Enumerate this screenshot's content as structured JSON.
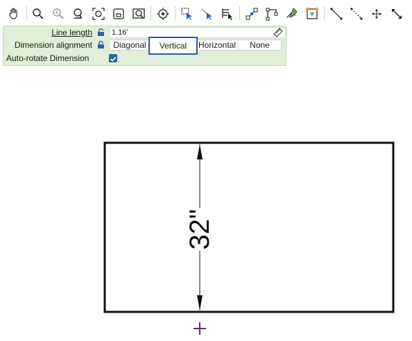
{
  "toolbar": {
    "icons": [
      "pan-hand-icon",
      "zoom-icon",
      "zoom-in-icon",
      "zoom-window-icon",
      "zoom-extents-icon",
      "zoom-previous-icon",
      "zoom-selection-icon",
      "snap-center-icon",
      "select-icon",
      "select-crossing-icon",
      "select-list-icon",
      "node-align-icon",
      "node-corner-icon",
      "node-edit-icon",
      "node-options-icon",
      "line-dots-icon",
      "line-dots-2-icon",
      "move-icon",
      "resize-icon"
    ]
  },
  "properties": {
    "line_length": {
      "label": "Line length",
      "value": "1.16'"
    },
    "dimension_alignment": {
      "label": "Dimension alignment",
      "options": [
        "Diagonal",
        "Vertical",
        "Horizontal",
        "None"
      ],
      "selected": "Vertical"
    },
    "auto_rotate": {
      "label": "Auto-rotate Dimension",
      "checked": true
    }
  },
  "drawing": {
    "dimension_text": "32\""
  },
  "colors": {
    "panel_bg": "#dfefd8",
    "selected_border": "#1d5fa8",
    "checkbox": "#2a64a8",
    "cursor": "#5a2a7a"
  }
}
